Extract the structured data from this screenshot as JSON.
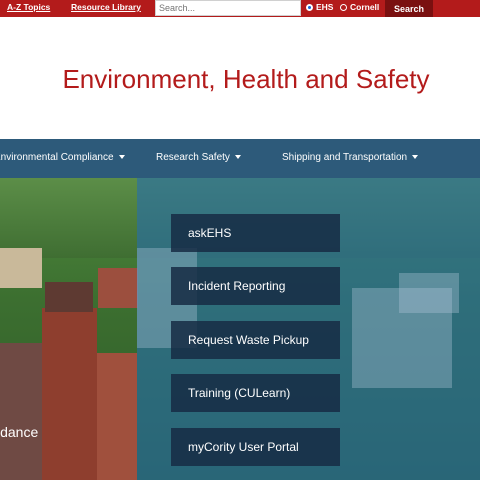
{
  "topbar": {
    "links": [
      "A-Z Topics",
      "Resource Library"
    ],
    "search_placeholder": "Search...",
    "radio_options": [
      {
        "label": "EHS",
        "checked": true
      },
      {
        "label": "Cornell",
        "checked": false
      }
    ],
    "search_button": "Search"
  },
  "header": {
    "title": "Environment, Health and Safety"
  },
  "nav": {
    "items": [
      "Environmental Compliance",
      "Research Safety",
      "Shipping and Transportation"
    ]
  },
  "hero": {
    "caption": "idance",
    "quick_links": [
      "askEHS",
      "Incident Reporting",
      "Request Waste Pickup",
      "Training (CULearn)",
      "myCority User Portal"
    ]
  },
  "colors": {
    "brand_red": "#b31b1b",
    "nav_blue": "#2d5a7a",
    "quick_link_bg": "#162c44"
  }
}
